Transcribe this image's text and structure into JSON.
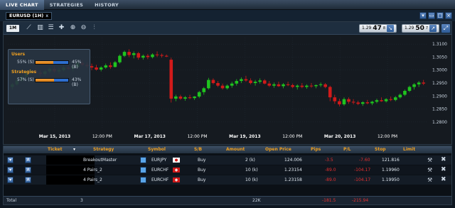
{
  "nav": {
    "tabs": [
      "LIVE CHART",
      "STRATEGIES",
      "HISTORY"
    ]
  },
  "chart_tab": {
    "label": "EURUSD (1H)",
    "close": "x"
  },
  "toolbar": {
    "timeframe": "1M",
    "bid": {
      "prefix": "1.29",
      "big": "47",
      "sup": "8"
    },
    "ask": {
      "prefix": "1.29",
      "big": "50",
      "sup": "7"
    }
  },
  "sentiment": {
    "users": {
      "title": "Users",
      "sell_label": "55% (S)",
      "buy_label": "45% (B)",
      "sell_pct": 55
    },
    "strategies": {
      "title": "Strategies",
      "sell_label": "57% (S)",
      "buy_label": "43% (B)",
      "sell_pct": 57
    }
  },
  "chart_data": {
    "type": "candlestick",
    "symbol": "EURUSD",
    "timeframe": "1H",
    "y_ticks": [
      "1.3100",
      "1.3050",
      "1.3000",
      "1.2950",
      "1.2900",
      "1.2850",
      "1.2800"
    ],
    "ylim": [
      1.2775,
      1.3125
    ],
    "x_ticks": [
      "Mar 15, 2013",
      "12:00 PM",
      "Mar 17, 2013",
      "12:00 PM",
      "Mar 19, 2013",
      "12:00 PM",
      "Mar 20, 2013",
      "12:00 PM"
    ],
    "colors": {
      "up": "#1fc41f",
      "down": "#d11a1a"
    },
    "candles": [
      [
        1.2935,
        1.295,
        1.2925,
        1.2945
      ],
      [
        1.2945,
        1.2965,
        1.294,
        1.296
      ],
      [
        1.296,
        1.298,
        1.2955,
        1.2975
      ],
      [
        1.2975,
        1.2995,
        1.297,
        1.299
      ],
      [
        1.299,
        1.3005,
        1.298,
        1.2998
      ],
      [
        1.2998,
        1.301,
        1.2985,
        1.299
      ],
      [
        1.299,
        1.3,
        1.2975,
        1.2985
      ],
      [
        1.2985,
        1.3,
        1.2978,
        1.2995
      ],
      [
        1.2995,
        1.3012,
        1.2988,
        1.3005
      ],
      [
        1.3005,
        1.3015,
        1.299,
        1.2995
      ],
      [
        1.2995,
        1.301,
        1.2985,
        1.3
      ],
      [
        1.3,
        1.302,
        1.2995,
        1.301
      ],
      [
        1.301,
        1.3025,
        1.3,
        1.3005
      ],
      [
        1.3005,
        1.3018,
        1.2995,
        1.3012
      ],
      [
        1.3012,
        1.3035,
        1.3008,
        1.3028
      ],
      [
        1.3028,
        1.304,
        1.3015,
        1.302
      ],
      [
        1.302,
        1.303,
        1.3008,
        1.3015
      ],
      [
        1.3015,
        1.3025,
        1.3,
        1.301
      ],
      [
        1.301,
        1.302,
        1.2998,
        1.3002
      ],
      [
        1.3002,
        1.3015,
        1.2995,
        1.301
      ],
      [
        1.301,
        1.3025,
        1.3005,
        1.3018
      ],
      [
        1.3018,
        1.303,
        1.3005,
        1.3012
      ],
      [
        1.3012,
        1.3035,
        1.301,
        1.303
      ],
      [
        1.303,
        1.306,
        1.3025,
        1.3055
      ],
      [
        1.3055,
        1.3075,
        1.305,
        1.307
      ],
      [
        1.307,
        1.308,
        1.305,
        1.3058
      ],
      [
        1.3058,
        1.3072,
        1.3045,
        1.3065
      ],
      [
        1.3065,
        1.307,
        1.304,
        1.3048
      ],
      [
        1.3048,
        1.306,
        1.304,
        1.3055
      ],
      [
        1.3055,
        1.3062,
        1.3042,
        1.305
      ],
      [
        1.305,
        1.3065,
        1.3045,
        1.306
      ],
      [
        1.306,
        1.3072,
        1.305,
        1.3058
      ],
      [
        1.3058,
        1.3064,
        1.3048,
        1.3055
      ],
      [
        1.3055,
        1.306,
        1.305,
        1.3052
      ],
      [
        1.304,
        1.3048,
        1.2875,
        1.289
      ],
      [
        1.289,
        1.2905,
        1.288,
        1.2898
      ],
      [
        1.2898,
        1.2905,
        1.2885,
        1.289
      ],
      [
        1.289,
        1.29,
        1.2882,
        1.2895
      ],
      [
        1.2895,
        1.2905,
        1.2888,
        1.2892
      ],
      [
        1.2892,
        1.29,
        1.2885,
        1.2898
      ],
      [
        1.2898,
        1.292,
        1.2892,
        1.2915
      ],
      [
        1.2915,
        1.2935,
        1.2905,
        1.293
      ],
      [
        1.293,
        1.297,
        1.2925,
        1.2962
      ],
      [
        1.2962,
        1.2968,
        1.2945,
        1.295
      ],
      [
        1.295,
        1.2958,
        1.2935,
        1.294
      ],
      [
        1.294,
        1.2948,
        1.2925,
        1.293
      ],
      [
        1.293,
        1.2945,
        1.2925,
        1.294
      ],
      [
        1.294,
        1.2955,
        1.2932,
        1.2948
      ],
      [
        1.2948,
        1.2965,
        1.294,
        1.2958
      ],
      [
        1.2958,
        1.2972,
        1.295,
        1.2965
      ],
      [
        1.2965,
        1.2978,
        1.2955,
        1.296
      ],
      [
        1.296,
        1.2968,
        1.2945,
        1.295
      ],
      [
        1.295,
        1.2962,
        1.294,
        1.2955
      ],
      [
        1.2955,
        1.2968,
        1.2948,
        1.296
      ],
      [
        1.296,
        1.2965,
        1.2945,
        1.2948
      ],
      [
        1.2948,
        1.2958,
        1.2935,
        1.294
      ],
      [
        1.294,
        1.2952,
        1.2932,
        1.2945
      ],
      [
        1.2945,
        1.2955,
        1.2935,
        1.2938
      ],
      [
        1.2938,
        1.295,
        1.293,
        1.2945
      ],
      [
        1.2945,
        1.2955,
        1.2938,
        1.2942
      ],
      [
        1.2942,
        1.2948,
        1.293,
        1.2935
      ],
      [
        1.2935,
        1.2945,
        1.2925,
        1.294
      ],
      [
        1.294,
        1.295,
        1.293,
        1.2935
      ],
      [
        1.2935,
        1.2945,
        1.2928,
        1.294
      ],
      [
        1.294,
        1.295,
        1.2932,
        1.2938
      ],
      [
        1.2938,
        1.2945,
        1.293,
        1.2942
      ],
      [
        1.2942,
        1.2952,
        1.2935,
        1.2945
      ],
      [
        1.2945,
        1.295,
        1.293,
        1.2935
      ],
      [
        1.2935,
        1.294,
        1.288,
        1.2895
      ],
      [
        1.2895,
        1.2905,
        1.287,
        1.288
      ],
      [
        1.288,
        1.289,
        1.286,
        1.2868
      ],
      [
        1.2868,
        1.2895,
        1.2862,
        1.2888
      ],
      [
        1.2888,
        1.2895,
        1.287,
        1.2878
      ],
      [
        1.2878,
        1.2888,
        1.2868,
        1.2875
      ],
      [
        1.2875,
        1.2882,
        1.2865,
        1.287
      ],
      [
        1.287,
        1.288,
        1.2862,
        1.2876
      ],
      [
        1.2876,
        1.2885,
        1.2868,
        1.2872
      ],
      [
        1.2872,
        1.2882,
        1.2865,
        1.2878
      ],
      [
        1.2878,
        1.289,
        1.2872,
        1.2884
      ],
      [
        1.2884,
        1.2895,
        1.2878,
        1.288
      ],
      [
        1.288,
        1.2892,
        1.2875,
        1.2888
      ],
      [
        1.2888,
        1.2898,
        1.288,
        1.2885
      ],
      [
        1.2885,
        1.29,
        1.288,
        1.2895
      ],
      [
        1.2895,
        1.291,
        1.289,
        1.2905
      ],
      [
        1.2905,
        1.2925,
        1.29,
        1.292
      ],
      [
        1.292,
        1.294,
        1.2915,
        1.2935
      ],
      [
        1.2935,
        1.295,
        1.2925,
        1.2945
      ],
      [
        1.2945,
        1.2958,
        1.2935,
        1.2952
      ],
      [
        1.2952,
        1.2962,
        1.2942,
        1.2948
      ]
    ]
  },
  "grid": {
    "headers": [
      "Ticket",
      "Strategy",
      "Symbol",
      "S/B",
      "Amount",
      "Open Price",
      "Pips",
      "P/L",
      "Stop",
      "Limit"
    ],
    "sort_marker": "▾",
    "rows": [
      {
        "a_btn": "A",
        "strategy": "BreakoutMaster",
        "symbol": "EURJPY",
        "sb": "Buy",
        "amount": "2 (k)",
        "open_price": "124.006",
        "pips": "-3.5",
        "pl": "-7.60",
        "stop": "121.816",
        "limit": ""
      },
      {
        "a_btn": "A",
        "strategy": "4 Pairs_2",
        "symbol": "EURCHF",
        "sb": "Buy",
        "amount": "10 (k)",
        "open_price": "1.23154",
        "pips": "-89.0",
        "pl": "-104.17",
        "stop": "1.19960",
        "limit": ""
      },
      {
        "a_btn": "A",
        "strategy": "4 Pairs_2",
        "symbol": "EURCHF",
        "sb": "Buy",
        "amount": "10 (k)",
        "open_price": "1.23158",
        "pips": "-89.0",
        "pl": "-104.17",
        "stop": "1.19950",
        "limit": ""
      }
    ],
    "total": {
      "label": "Total",
      "count": "3",
      "amount": "22K",
      "pips": "-181.5",
      "pl": "-215.94"
    }
  }
}
